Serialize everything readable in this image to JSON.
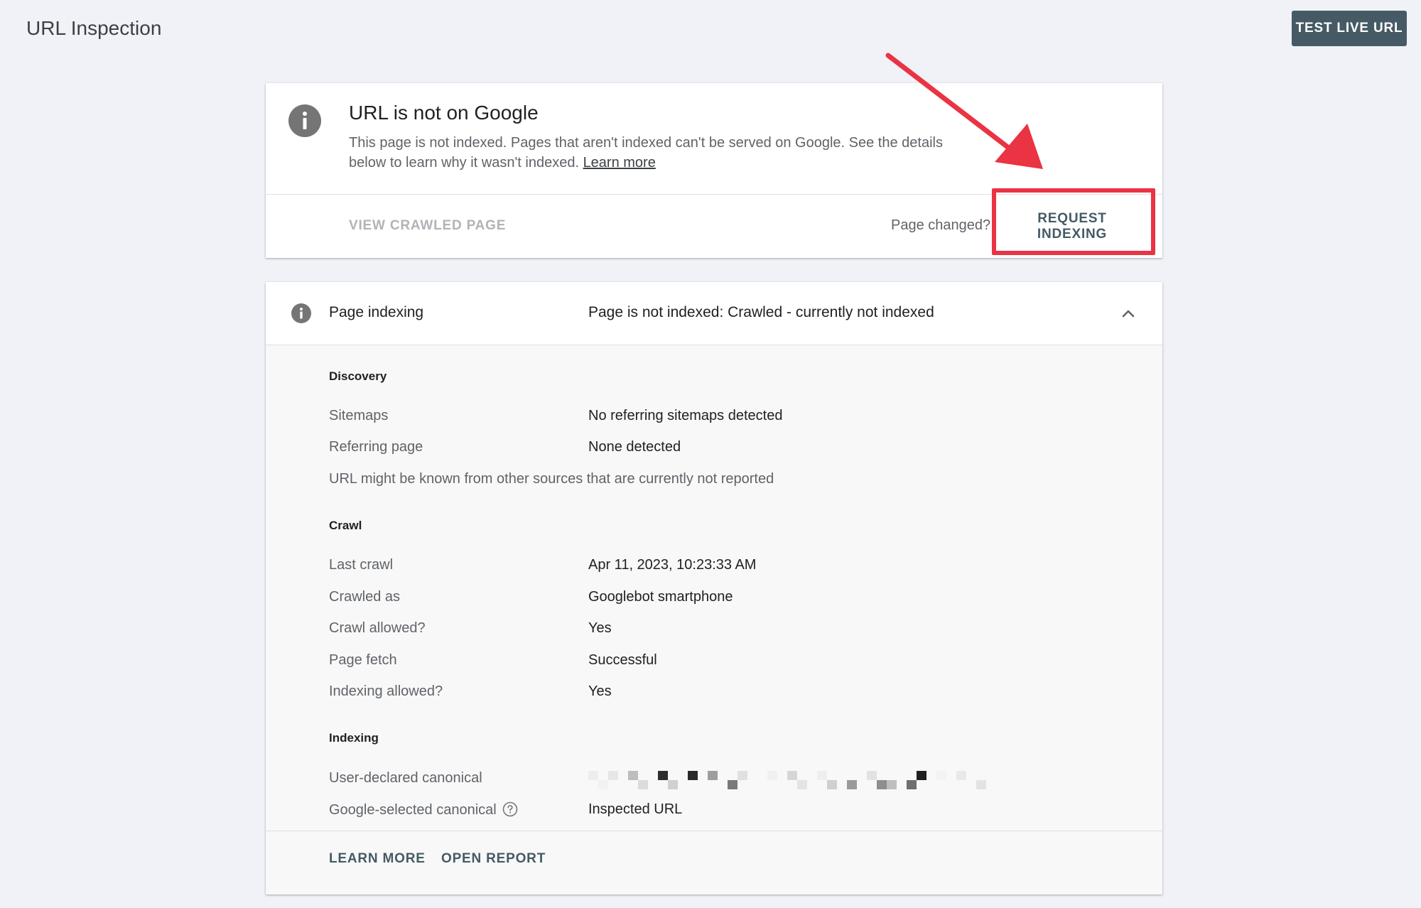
{
  "header": {
    "title": "URL Inspection",
    "test_live_label": "TEST LIVE URL"
  },
  "status": {
    "heading": "URL is not on Google",
    "description": "This page is not indexed. Pages that aren't indexed can't be served on Google. See the details below to learn why it wasn't indexed.",
    "learn_more": "Learn more",
    "view_crawled_label": "VIEW CRAWLED PAGE",
    "page_changed_text": "Page changed?",
    "request_indexing_label": "REQUEST INDEXING"
  },
  "indexing": {
    "title": "Page indexing",
    "status": "Page is not indexed: Crawled - currently not indexed",
    "discovery": {
      "title": "Discovery",
      "sitemaps_label": "Sitemaps",
      "sitemaps_value": "No referring sitemaps detected",
      "referring_label": "Referring page",
      "referring_value": "None detected",
      "note": "URL might be known from other sources that are currently not reported"
    },
    "crawl": {
      "title": "Crawl",
      "rows": [
        {
          "label": "Last crawl",
          "value": "Apr 11, 2023, 10:23:33 AM"
        },
        {
          "label": "Crawled as",
          "value": "Googlebot smartphone"
        },
        {
          "label": "Crawl allowed?",
          "value": "Yes"
        },
        {
          "label": "Page fetch",
          "value": "Successful"
        },
        {
          "label": "Indexing allowed?",
          "value": "Yes"
        }
      ]
    },
    "indexing_section": {
      "title": "Indexing",
      "user_canonical_label": "User-declared canonical",
      "google_canonical_label": "Google-selected canonical",
      "google_canonical_value": "Inspected URL"
    },
    "footer": {
      "learn_more_label": "LEARN MORE",
      "open_report_label": "OPEN REPORT"
    }
  },
  "icons": {
    "status_icon": "info-icon",
    "row_icon": "info-icon",
    "collapse_icon": "chevron-up-icon",
    "help_icon": "help-circle-icon",
    "annotation": "red-arrow"
  },
  "colors": {
    "background": "#f0f2f7",
    "primary_button": "#455a64",
    "highlight": "#ea3343",
    "icon_gray": "#757575"
  }
}
